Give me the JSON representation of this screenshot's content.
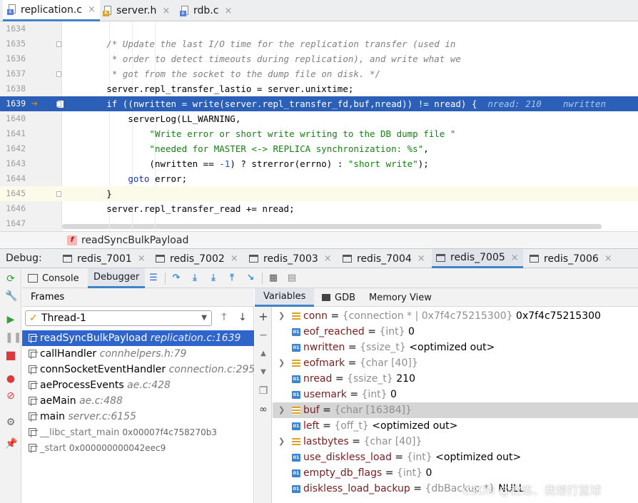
{
  "editor_tabs": [
    {
      "label": "replication.c",
      "badge": "c",
      "badge_color": "#5b7fd6",
      "active": true
    },
    {
      "label": "server.h",
      "badge": "h",
      "badge_color": "#d6a33b",
      "active": false
    },
    {
      "label": "rdb.c",
      "badge": "c",
      "badge_color": "#5b7fd6",
      "active": false
    }
  ],
  "close_glyph": "×",
  "code_lines": [
    {
      "num": "1634",
      "segments": [
        {
          "t": "",
          "k": "p"
        }
      ]
    },
    {
      "num": "1635",
      "segments": [
        {
          "t": "        ",
          "k": "p"
        },
        {
          "t": "/* Update the last I/O time for the replication transfer (used in",
          "k": "cm"
        }
      ]
    },
    {
      "num": "1636",
      "segments": [
        {
          "t": "         ",
          "k": "p"
        },
        {
          "t": "* order to detect timeouts during replication), and write what we",
          "k": "cm"
        }
      ]
    },
    {
      "num": "1637",
      "segments": [
        {
          "t": "         ",
          "k": "p"
        },
        {
          "t": "* got from the socket to the dump file on disk. */",
          "k": "cm"
        }
      ]
    },
    {
      "num": "1638",
      "segments": [
        {
          "t": "        server.repl_transfer_lastio = server.unixtime;",
          "k": "p"
        }
      ]
    },
    {
      "num": "1639",
      "segments": [
        {
          "t": "        if ((nwritten = write(server.repl_transfer_fd,buf,nread)) != nread) ",
          "k": "p"
        },
        {
          "t": "{",
          "k": "p"
        },
        {
          "t": "  nread: 210    nwritten",
          "k": "inlay"
        }
      ]
    },
    {
      "num": "1640",
      "segments": [
        {
          "t": "            serverLog(LL_WARNING,",
          "k": "p"
        }
      ]
    },
    {
      "num": "1641",
      "segments": [
        {
          "t": "                ",
          "k": "p"
        },
        {
          "t": "\"Write error or short write writing to the DB dump file \"",
          "k": "st"
        }
      ]
    },
    {
      "num": "1642",
      "segments": [
        {
          "t": "                ",
          "k": "p"
        },
        {
          "t": "\"needed for MASTER <-> REPLICA synchronization: %s\"",
          "k": "st"
        },
        {
          "t": ",",
          "k": "p"
        }
      ]
    },
    {
      "num": "1643",
      "segments": [
        {
          "t": "                (nwritten == ",
          "k": "p"
        },
        {
          "t": "-1",
          "k": "num"
        },
        {
          "t": ") ? strerror(errno) : ",
          "k": "p"
        },
        {
          "t": "\"short write\"",
          "k": "st"
        },
        {
          "t": ");",
          "k": "p"
        }
      ]
    },
    {
      "num": "1644",
      "segments": [
        {
          "t": "            ",
          "k": "p"
        },
        {
          "t": "goto",
          "k": "kw"
        },
        {
          "t": " error;",
          "k": "p"
        }
      ]
    },
    {
      "num": "1645",
      "segments": [
        {
          "t": "        }",
          "k": "p"
        }
      ]
    },
    {
      "num": "1646",
      "segments": [
        {
          "t": "        server.repl_transfer_read += nread;",
          "k": "p"
        }
      ]
    },
    {
      "num": "1647",
      "segments": [
        {
          "t": "",
          "k": "p"
        }
      ]
    }
  ],
  "breadcrumb": {
    "badge": "f",
    "label": "readSyncBulkPayload"
  },
  "debug": {
    "label": "Debug:",
    "sessions": [
      "redis_7001",
      "redis_7002",
      "redis_7003",
      "redis_7004",
      "redis_7005",
      "redis_7006"
    ],
    "active_session": 4
  },
  "toolbar_tabs": [
    "Console",
    "Debugger"
  ],
  "frames": {
    "header": "Frames",
    "thread": "Thread-1",
    "items": [
      {
        "fn": "readSyncBulkPayload",
        "loc": "replication.c:1639",
        "addr": "",
        "selected": true,
        "lib": false
      },
      {
        "fn": "callHandler",
        "loc": "connhelpers.h:79",
        "addr": "",
        "selected": false,
        "lib": false
      },
      {
        "fn": "connSocketEventHandler",
        "loc": "connection.c:295",
        "addr": "",
        "selected": false,
        "lib": false
      },
      {
        "fn": "aeProcessEvents",
        "loc": "ae.c:428",
        "addr": "",
        "selected": false,
        "lib": false
      },
      {
        "fn": "aeMain",
        "loc": "ae.c:488",
        "addr": "",
        "selected": false,
        "lib": false
      },
      {
        "fn": "main",
        "loc": "server.c:6155",
        "addr": "",
        "selected": false,
        "lib": false
      },
      {
        "fn": "__libc_start_main",
        "loc": "",
        "addr": "0x00007f4c758270b3",
        "selected": false,
        "lib": true
      },
      {
        "fn": "_start",
        "loc": "",
        "addr": "0x000000000042eec9",
        "selected": false,
        "lib": true
      }
    ]
  },
  "variables_tabs": [
    "Variables",
    "GDB",
    "Memory View"
  ],
  "variables": [
    {
      "name": "conn",
      "type": "{connection * | 0x7f4c75215300}",
      "value": "0x7f4c75215300",
      "icon": "struct",
      "expandable": true,
      "selected": false
    },
    {
      "name": "eof_reached",
      "type": "{int}",
      "value": "0",
      "icon": "prim",
      "expandable": false,
      "selected": false
    },
    {
      "name": "nwritten",
      "type": "{ssize_t}",
      "value": "<optimized out>",
      "icon": "prim",
      "expandable": false,
      "selected": false
    },
    {
      "name": "eofmark",
      "type": "{char [40]}",
      "value": "",
      "icon": "struct",
      "expandable": true,
      "selected": false
    },
    {
      "name": "nread",
      "type": "{ssize_t}",
      "value": "210",
      "icon": "prim",
      "expandable": false,
      "selected": false
    },
    {
      "name": "usemark",
      "type": "{int}",
      "value": "0",
      "icon": "prim",
      "expandable": false,
      "selected": false
    },
    {
      "name": "buf",
      "type": "{char [16384]}",
      "value": "",
      "icon": "struct",
      "expandable": true,
      "selected": true
    },
    {
      "name": "left",
      "type": "{off_t}",
      "value": "<optimized out>",
      "icon": "prim",
      "expandable": false,
      "selected": false
    },
    {
      "name": "lastbytes",
      "type": "{char [40]}",
      "value": "",
      "icon": "struct",
      "expandable": true,
      "selected": false
    },
    {
      "name": "use_diskless_load",
      "type": "{int}",
      "value": "<optimized out>",
      "icon": "prim",
      "expandable": false,
      "selected": false
    },
    {
      "name": "empty_db_flags",
      "type": "{int}",
      "value": "0",
      "icon": "prim",
      "expandable": false,
      "selected": false
    },
    {
      "name": "diskless_load_backup",
      "type": "{dbBackup *}",
      "value": "NULL",
      "icon": "prim",
      "expandable": false,
      "selected": false
    }
  ],
  "watermark": "CSDN @教练、我想打篮球",
  "colors": {
    "accent": "#4083c9",
    "selection": "#2f65ca",
    "exec_line": "#2b5fb8"
  }
}
